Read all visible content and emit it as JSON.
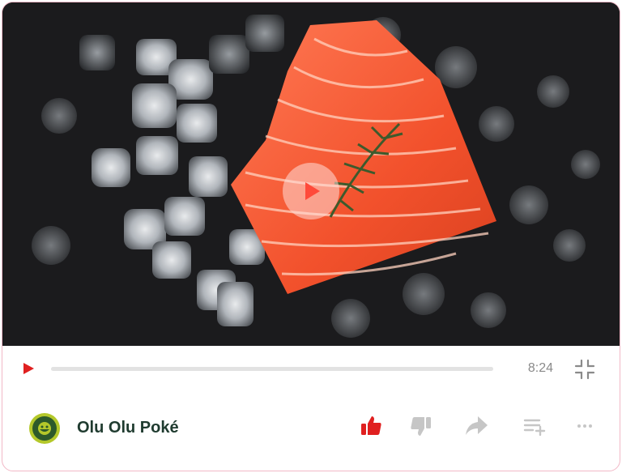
{
  "player": {
    "duration": "8:24",
    "progress_fraction": 0.0
  },
  "channel": {
    "name": "Olu Olu Poké",
    "logo_text_top": "OLU OLU",
    "logo_text_bottom": "POKÉ"
  },
  "actions": {
    "like_icon": "thumbs-up-icon",
    "dislike_icon": "thumbs-down-icon",
    "share_icon": "share-arrow-icon",
    "playlist_icon": "add-to-playlist-icon",
    "more_icon": "more-dots-icon"
  },
  "colors": {
    "accent": "#e02020",
    "border": "#f2b8c6",
    "channel_text": "#1f3b2f",
    "muted_icon": "#c6c6c6"
  }
}
